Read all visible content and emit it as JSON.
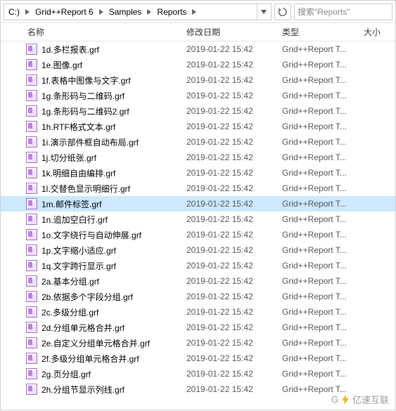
{
  "breadcrumb": {
    "segments": [
      "C:)",
      "Grid++Report 6",
      "Samples",
      "Reports"
    ]
  },
  "search": {
    "placeholder": "搜索\"Reports\""
  },
  "columns": {
    "name": "名称",
    "date": "修改日期",
    "type": "类型",
    "size": "大小"
  },
  "file_type_label": "Grid++Report T...",
  "files": [
    {
      "name": "1d.多栏报表.grf",
      "date": "2019-01-22 15:42",
      "selected": false
    },
    {
      "name": "1e.图像.grf",
      "date": "2019-01-22 15:42",
      "selected": false
    },
    {
      "name": "1f.表格中图像与文字.grf",
      "date": "2019-01-22 15:42",
      "selected": false
    },
    {
      "name": "1g.条形码与二维码.grf",
      "date": "2019-01-22 15:42",
      "selected": false
    },
    {
      "name": "1g.条形码与二维码2.grf",
      "date": "2019-01-22 15:42",
      "selected": false
    },
    {
      "name": "1h.RTF格式文本.grf",
      "date": "2019-01-22 15:42",
      "selected": false
    },
    {
      "name": "1i.演示部件框自动布局.grf",
      "date": "2019-01-22 15:42",
      "selected": false
    },
    {
      "name": "1j.切分纸张.grf",
      "date": "2019-01-22 15:42",
      "selected": false
    },
    {
      "name": "1k.明细自由编排.grf",
      "date": "2019-01-22 15:42",
      "selected": false
    },
    {
      "name": "1l.交替色显示明细行.grf",
      "date": "2019-01-22 15:42",
      "selected": false
    },
    {
      "name": "1m.邮件标签.grf",
      "date": "2019-01-22 15:42",
      "selected": true
    },
    {
      "name": "1n.追加空白行.grf",
      "date": "2019-01-22 15:42",
      "selected": false
    },
    {
      "name": "1o.文字绕行与自动伸展.grf",
      "date": "2019-01-22 15:42",
      "selected": false
    },
    {
      "name": "1p.文字缩小适应.grf",
      "date": "2019-01-22 15:42",
      "selected": false
    },
    {
      "name": "1q.文字跨行显示.grf",
      "date": "2019-01-22 15:42",
      "selected": false
    },
    {
      "name": "2a.基本分组.grf",
      "date": "2019-01-22 15:42",
      "selected": false
    },
    {
      "name": "2b.依据多个字段分组.grf",
      "date": "2019-01-22 15:42",
      "selected": false
    },
    {
      "name": "2c.多级分组.grf",
      "date": "2019-01-22 15:42",
      "selected": false
    },
    {
      "name": "2d.分组单元格合并.grf",
      "date": "2019-01-22 15:42",
      "selected": false
    },
    {
      "name": "2e.自定义分组单元格合并.grf",
      "date": "2019-01-22 15:42",
      "selected": false
    },
    {
      "name": "2f.多级分组单元格合并.grf",
      "date": "2019-01-22 15:42",
      "selected": false
    },
    {
      "name": "2g.页分组.grf",
      "date": "2019-01-22 15:42",
      "selected": false
    },
    {
      "name": "2h.分组节显示列线.grf",
      "date": "2019-01-22 15:42",
      "selected": false
    }
  ],
  "watermark": {
    "text_left": "G",
    "text_right": "亿速互联"
  }
}
